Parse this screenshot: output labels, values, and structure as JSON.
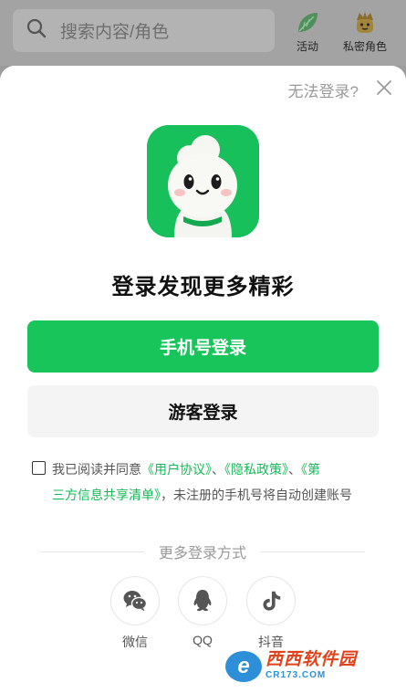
{
  "search": {
    "placeholder": "搜索内容/角色"
  },
  "top_actions": [
    {
      "label": "活动",
      "icon": "activity-leaf-icon"
    },
    {
      "label": "私密角色",
      "icon": "private-character-icon"
    }
  ],
  "sheet": {
    "cant_login": "无法登录?",
    "title": "登录发现更多精彩",
    "phone_login": "手机号登录",
    "guest_login": "游客登录",
    "agreement": {
      "checked": false,
      "prefix": "我已阅读并同意",
      "user_agreement": "《用户协议》",
      "sep1": "、",
      "privacy_policy": "《隐私政策》",
      "sep2": "、",
      "third_party_part1": "《第",
      "third_party_part2": "三方信息共享清单》",
      "suffix": "，未注册的手机号将自动创建账号"
    },
    "more_login": "更多登录方式",
    "options": [
      {
        "label": "微信",
        "icon": "wechat-icon"
      },
      {
        "label": "QQ",
        "icon": "qq-icon"
      },
      {
        "label": "抖音",
        "icon": "douyin-icon"
      }
    ]
  },
  "watermark": {
    "logo_letter": "e",
    "main": "西西软件园",
    "sub": "CR173.COM"
  },
  "colors": {
    "accent": "#17c55b",
    "link": "#17b857",
    "overlay": "#9c9c9c"
  }
}
